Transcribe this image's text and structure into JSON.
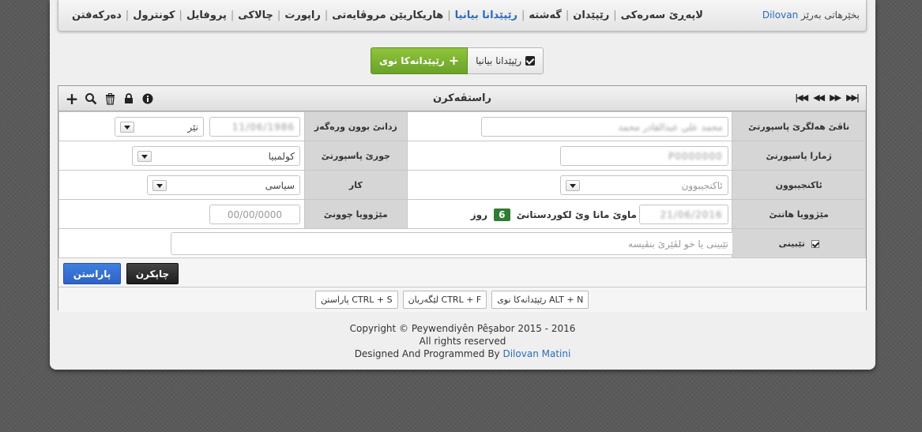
{
  "nav": {
    "welcome": "بخێرهاتی بەرێز",
    "username": "Dilovan",
    "items": [
      {
        "label": "لاپەڕێ سەرەکی"
      },
      {
        "label": "رێپێدان"
      },
      {
        "label": "گەشتە"
      },
      {
        "label": "رێپێدانا بیانیا"
      },
      {
        "label": "هاریکاریێن مروڤایەتی"
      },
      {
        "label": "راپورت"
      },
      {
        "label": "چالاکی"
      },
      {
        "label": "پروفایل"
      },
      {
        "label": "کونترول"
      },
      {
        "label": "دەرکەفتن"
      }
    ]
  },
  "top_buttons": {
    "list_label": "رێپێدانا بیانیا",
    "new_label": "رێپێدانەکا نوی"
  },
  "form": {
    "title": "راستڤەکرن",
    "tools": [
      "plus-icon",
      "search-icon",
      "trash-icon",
      "lock-icon",
      "info-icon"
    ],
    "pager": [
      "first",
      "prev",
      "next",
      "last"
    ],
    "labels": {
      "full_name": "ناڤێ هەلگرێ پاسپورتێ",
      "end_date": "زدانێ بوون ورەگەز",
      "passport_no": "ژمارا پاسپورتێ",
      "passport_type": "جورێ پاسپورتێ",
      "nationality": "ئاکنجیبوون",
      "work": "کار",
      "arrival_date": "مێژوویا هاتنێ",
      "departure_date": "مێژوویا چوونێ",
      "notes": "تێبینی"
    },
    "values": {
      "full_name": "محمد علي عبدالقادر محمد",
      "birth_value": "11/06/1986",
      "gender": "نێر",
      "passport_no": "P0000000",
      "passport_type": "کولمبیا",
      "nationality_placeholder": "ئاکنجیبوون",
      "work": "سیاسی",
      "arrival_date": "21/06/2016",
      "stay_prefix": "ماوێ مانا وێ لکوردستانێ",
      "stay_days": "6",
      "stay_suffix": "روز",
      "departure_placeholder": "00/00/0000",
      "notes_placeholder": "تێبینی یا خو لڤێرێ بنڤیسە"
    }
  },
  "actions": {
    "save": "پاراستن",
    "print": "چاپکرن"
  },
  "shortcuts": [
    {
      "keys": "ALT + N",
      "label": "رێپێدانەکا نوی"
    },
    {
      "keys": "CTRL + F",
      "label": "لێگەریان"
    },
    {
      "keys": "CTRL + S",
      "label": "پاراستن"
    }
  ],
  "footer": {
    "line1": "Copyright © Peywendiyên Pêşabor 2015 - 2016",
    "line2": "All rights reserved",
    "line3_prefix": "Designed And Programmed By",
    "author": "Dilovan Matini"
  }
}
